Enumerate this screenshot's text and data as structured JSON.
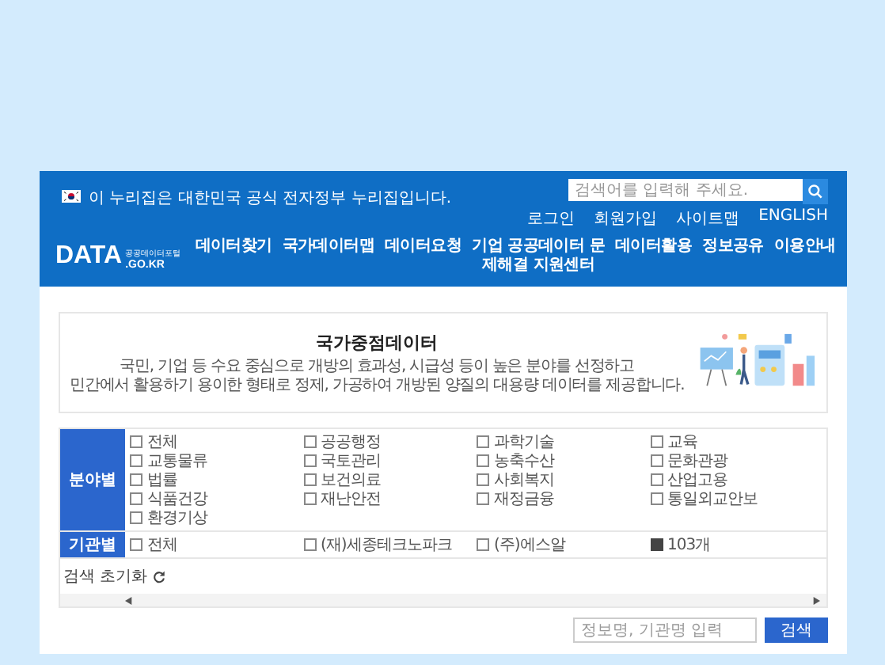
{
  "notice": {
    "text": "이 누리집은 대한민국 공식 전자정부 누리집입니다."
  },
  "search": {
    "placeholder": "검색어를 입력해 주세요."
  },
  "util_links": [
    "로그인",
    "회원가입",
    "사이트맵",
    "ENGLISH"
  ],
  "logo": {
    "main": "DATA",
    "sub_top": "공공데이터포털",
    "sub_bottom": ".GO.KR"
  },
  "nav": [
    "데이터찾기",
    "국가데이터맵",
    "데이터요청",
    "기업 공공데이터 문제해결 지원센터",
    "데이터활용",
    "정보공유",
    "이용안내"
  ],
  "intro": {
    "title": "국가중점데이터",
    "lines": [
      "국민, 기업 등 수요 중심으로 개방의 효과성, 시급성 등이 높은 분야를 선정하고",
      "민간에서 활용하기 용이한 형태로 정제, 가공하여 개방된 양질의 대용량 데이터를 제공합니다."
    ]
  },
  "filters": [
    {
      "label": "분야별",
      "options": [
        {
          "label": "전체",
          "checked": false
        },
        {
          "label": "공공행정",
          "checked": false
        },
        {
          "label": "과학기술",
          "checked": false
        },
        {
          "label": "교육",
          "checked": false
        },
        {
          "label": "교통물류",
          "checked": false
        },
        {
          "label": "국토관리",
          "checked": false
        },
        {
          "label": "농축수산",
          "checked": false
        },
        {
          "label": "문화관광",
          "checked": false
        },
        {
          "label": "법률",
          "checked": false
        },
        {
          "label": "보건의료",
          "checked": false
        },
        {
          "label": "사회복지",
          "checked": false
        },
        {
          "label": "산업고용",
          "checked": false
        },
        {
          "label": "식품건강",
          "checked": false
        },
        {
          "label": "재난안전",
          "checked": false
        },
        {
          "label": "재정금융",
          "checked": false
        },
        {
          "label": "통일외교안보",
          "checked": false
        },
        {
          "label": "환경기상",
          "checked": false
        }
      ]
    },
    {
      "label": "기관별",
      "options": [
        {
          "label": "전체",
          "checked": false
        },
        {
          "label": "(재)세종테크노파크",
          "checked": false
        },
        {
          "label": "(주)에스알",
          "checked": false
        }
      ],
      "more": {
        "label": "103개"
      }
    }
  ],
  "reset": {
    "label": "검색 초기화"
  },
  "bottom_search": {
    "placeholder": "정보명, 기관명 입력",
    "button": "검색"
  }
}
